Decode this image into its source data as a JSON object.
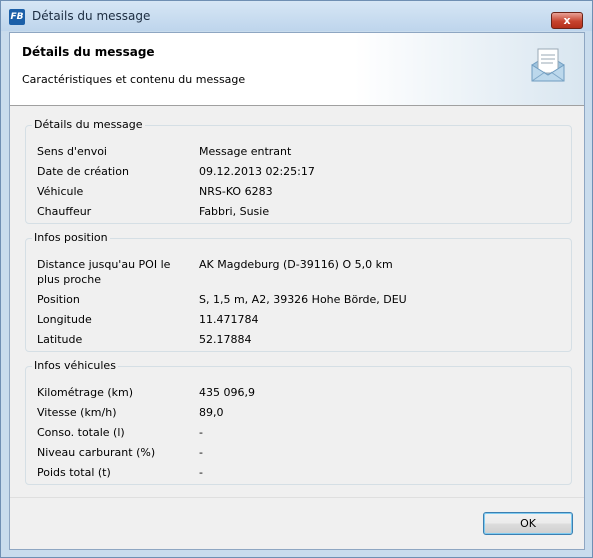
{
  "window": {
    "title": "Détails du message",
    "close_label": "x"
  },
  "header": {
    "title": "Détails du message",
    "subtitle": "Caractéristiques et contenu du message"
  },
  "message_details": {
    "title": "Détails du message",
    "rows": [
      {
        "label": "Sens d'envoi",
        "value": "Message entrant"
      },
      {
        "label": "Date de création",
        "value": "09.12.2013 02:25:17"
      },
      {
        "label": "Véhicule",
        "value": "NRS-KO 6283"
      },
      {
        "label": "Chauffeur",
        "value": "Fabbri, Susie"
      }
    ]
  },
  "position_info": {
    "title": "Infos position",
    "rows": [
      {
        "label": "Distance jusqu'au POI le",
        "label2": "plus proche",
        "value": "AK Magdeburg (D-39116) O 5,0 km"
      },
      {
        "label": "Position",
        "value": "S, 1,5 m, A2, 39326 Hohe Börde, DEU"
      },
      {
        "label": "Longitude",
        "value": "11.471784"
      },
      {
        "label": "Latitude",
        "value": "52.17884"
      }
    ]
  },
  "vehicle_info": {
    "title": "Infos véhicules",
    "rows": [
      {
        "label": "Kilométrage (km)",
        "value": "435 096,9"
      },
      {
        "label": "Vitesse (km/h)",
        "value": "89,0"
      },
      {
        "label": "Conso. totale (l)",
        "value": "-"
      },
      {
        "label": "Niveau carburant (%)",
        "value": "-"
      },
      {
        "label": "Poids total (t)",
        "value": "-"
      }
    ]
  },
  "footer": {
    "ok_label": "OK"
  },
  "icons": {
    "app": "fb-logo-icon",
    "header": "envelope-letter-icon"
  }
}
